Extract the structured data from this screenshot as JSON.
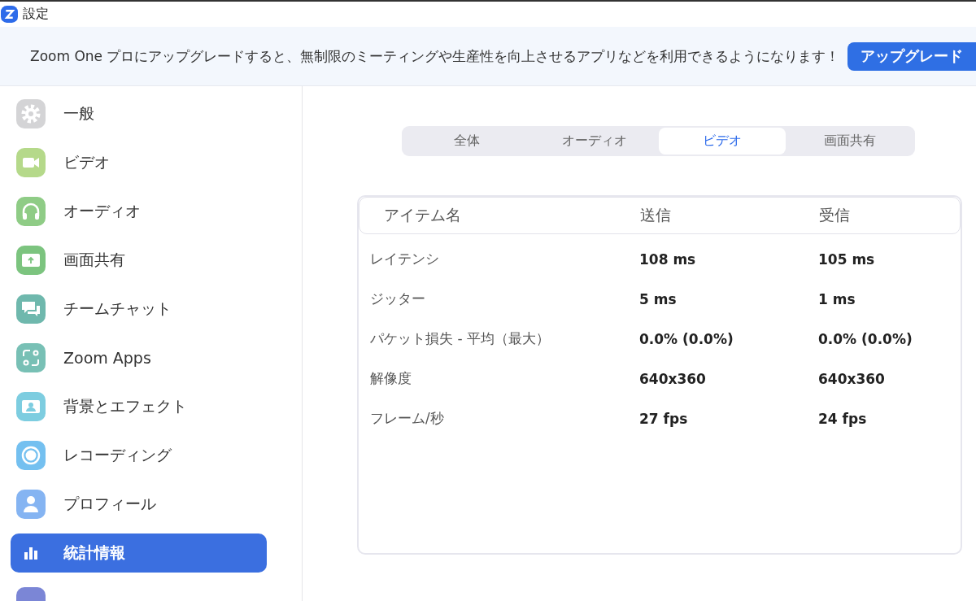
{
  "window": {
    "title": "設定"
  },
  "banner": {
    "text": "Zoom One プロにアップグレードすると、無制限のミーティングや生産性を向上させるアプリなどを利用できるようになります！",
    "button": "アップグレード"
  },
  "sidebar": {
    "items": [
      {
        "label": "一般",
        "color": "#d4d4d6",
        "selected": false
      },
      {
        "label": "ビデオ",
        "color": "#b5d98a",
        "selected": false
      },
      {
        "label": "オーディオ",
        "color": "#8fcc86",
        "selected": false
      },
      {
        "label": "画面共有",
        "color": "#7cc47f",
        "selected": false
      },
      {
        "label": "チームチャット",
        "color": "#6fb8ad",
        "selected": false
      },
      {
        "label": "Zoom Apps",
        "color": "#78c0b5",
        "selected": false
      },
      {
        "label": "背景とエフェクト",
        "color": "#7dcde0",
        "selected": false
      },
      {
        "label": "レコーディング",
        "color": "#74c0f0",
        "selected": false
      },
      {
        "label": "プロフィール",
        "color": "#85b4f2",
        "selected": false
      },
      {
        "label": "統計情報",
        "color": "#3b6fe0",
        "selected": true
      },
      {
        "color": "#7b86d6",
        "selected": false
      }
    ]
  },
  "tabs": [
    {
      "label": "全体",
      "selected": false
    },
    {
      "label": "オーディオ",
      "selected": false
    },
    {
      "label": "ビデオ",
      "selected": true
    },
    {
      "label": "画面共有",
      "selected": false
    }
  ],
  "table": {
    "columns": [
      "アイテム名",
      "送信",
      "受信"
    ],
    "rows": [
      {
        "cells": [
          "レイテンシ",
          "108 ms",
          "105 ms"
        ]
      },
      {
        "cells": [
          "ジッター",
          "5 ms",
          "1 ms"
        ]
      },
      {
        "cells": [
          "パケット損失 - 平均（最大）",
          "0.0% (0.0%)",
          "0.0% (0.0%)"
        ]
      },
      {
        "cells": [
          "解像度",
          "640x360",
          "640x360"
        ]
      },
      {
        "cells": [
          "フレーム/秒",
          "27 fps",
          "24 fps"
        ]
      }
    ]
  }
}
